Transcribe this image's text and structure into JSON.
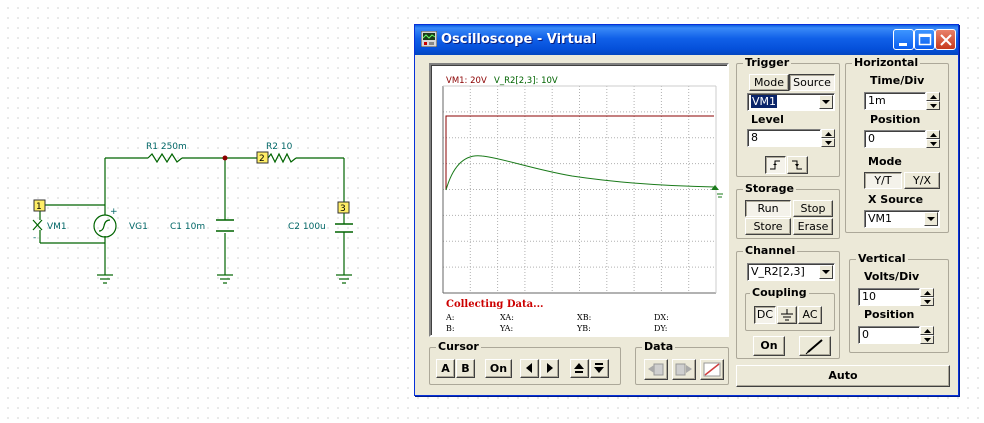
{
  "window": {
    "title": "Oscilloscope - Virtual"
  },
  "schematic": {
    "components": {
      "r1": "R1 250m",
      "r2": "R2 10",
      "c1": "C1 10m",
      "c2": "C2 100u",
      "source": "VG1",
      "meter": "VM1"
    },
    "nodes": {
      "n1": "1",
      "n2": "2",
      "n3": "3"
    },
    "pins": {
      "plus": "+",
      "minus": "-"
    }
  },
  "display": {
    "ch1_label": "VM1: 20V",
    "ch2_label": "V_R2[2,3]: 10V",
    "status": "Collecting Data...",
    "measurements": {
      "a": "A:",
      "b": "B:",
      "xa": "XA:",
      "ya": "YA:",
      "xb": "XB:",
      "yb": "YB:",
      "dx": "DX:",
      "dy": "DY:"
    },
    "colors": {
      "ch1": "#8b0000",
      "ch2": "#006400",
      "grid": "#b0b0b0"
    }
  },
  "trigger": {
    "title": "Trigger",
    "mode_label": "Mode",
    "source_label": "Source",
    "source_value": "VM1",
    "level_label": "Level",
    "level_value": "8"
  },
  "horizontal": {
    "title": "Horizontal",
    "timediv_label": "Time/Div",
    "timediv_value": "1m",
    "position_label": "Position",
    "position_value": "0",
    "mode_label": "Mode",
    "yt_label": "Y/T",
    "yx_label": "Y/X",
    "xsource_label": "X Source",
    "xsource_value": "VM1"
  },
  "storage": {
    "title": "Storage",
    "run": "Run",
    "stop": "Stop",
    "store": "Store",
    "erase": "Erase"
  },
  "channel": {
    "title": "Channel",
    "value": "V_R2[2,3]",
    "coupling_title": "Coupling",
    "dc": "DC",
    "ac": "AC",
    "on": "On"
  },
  "vertical": {
    "title": "Vertical",
    "voltsdiv_label": "Volts/Div",
    "voltsdiv_value": "10",
    "position_label": "Position",
    "position_value": "0"
  },
  "cursor": {
    "title": "Cursor",
    "a": "A",
    "b": "B",
    "on": "On"
  },
  "data": {
    "title": "Data"
  },
  "auto": "Auto"
}
